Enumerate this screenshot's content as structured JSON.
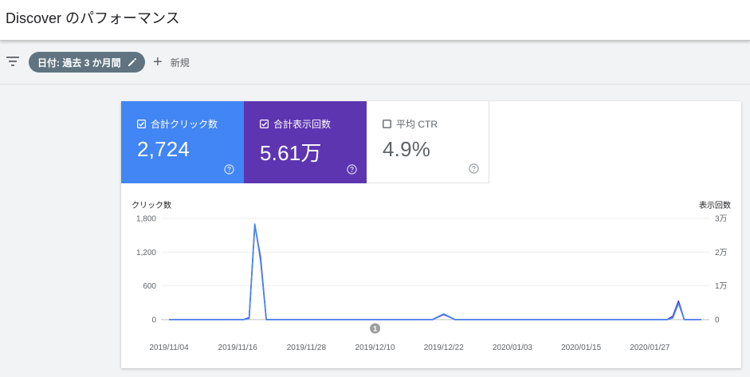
{
  "header": {
    "title_app": "Discover",
    "title_rest": " のパフォーマンス"
  },
  "filterbar": {
    "date_chip": "日付: 過去 3 か月間",
    "add_label": "新規"
  },
  "metrics": [
    {
      "label": "合計クリック数",
      "value": "2,724",
      "checked": true,
      "color": "#4285f4"
    },
    {
      "label": "合計表示回数",
      "value": "5.61万",
      "checked": true,
      "color": "#5e35b1"
    },
    {
      "label": "平均 CTR",
      "value": "4.9%",
      "checked": false,
      "color": "#ffffff"
    }
  ],
  "chart_data": {
    "type": "line",
    "y_left_label": "クリック数",
    "y_right_label": "表示回数",
    "y_left_ticks": [
      "1,800",
      "1,200",
      "600",
      "0"
    ],
    "y_right_ticks": [
      "3万",
      "2万",
      "1万",
      "0"
    ],
    "ylim_left": [
      0,
      1800
    ],
    "ylim_right": [
      0,
      30000
    ],
    "x_tick_labels": [
      "2019/11/04",
      "2019/11/16",
      "2019/11/28",
      "2019/12/10",
      "2019/12/22",
      "2020/01/03",
      "2020/01/15",
      "2020/01/27"
    ],
    "x_range": [
      "2019/11/04",
      "2020/02/05"
    ],
    "annotation": "1",
    "annotation_x": "2019/12/10",
    "series": [
      {
        "name": "合計クリック数",
        "axis": "left",
        "color": "#4285f4",
        "points": [
          [
            "2019/11/04",
            0
          ],
          [
            "2019/11/17",
            0
          ],
          [
            "2019/11/18",
            20
          ],
          [
            "2019/11/19",
            1700
          ],
          [
            "2019/11/20",
            1050
          ],
          [
            "2019/11/21",
            0
          ],
          [
            "2019/12/20",
            0
          ],
          [
            "2019/12/22",
            100
          ],
          [
            "2019/12/24",
            0
          ],
          [
            "2020/01/30",
            0
          ],
          [
            "2020/01/31",
            30
          ],
          [
            "2020/02/01",
            290
          ],
          [
            "2020/02/02",
            0
          ],
          [
            "2020/02/05",
            0
          ]
        ]
      },
      {
        "name": "合計表示回数",
        "axis": "right",
        "color": "#5e35b1",
        "points": [
          [
            "2019/11/04",
            0
          ],
          [
            "2019/11/17",
            0
          ],
          [
            "2019/11/18",
            600
          ],
          [
            "2019/11/19",
            28000
          ],
          [
            "2019/11/20",
            18500
          ],
          [
            "2019/11/21",
            0
          ],
          [
            "2019/12/20",
            0
          ],
          [
            "2019/12/22",
            1500
          ],
          [
            "2019/12/24",
            0
          ],
          [
            "2020/01/30",
            0
          ],
          [
            "2020/01/31",
            1000
          ],
          [
            "2020/02/01",
            5500
          ],
          [
            "2020/02/02",
            0
          ],
          [
            "2020/02/05",
            0
          ]
        ]
      }
    ]
  }
}
